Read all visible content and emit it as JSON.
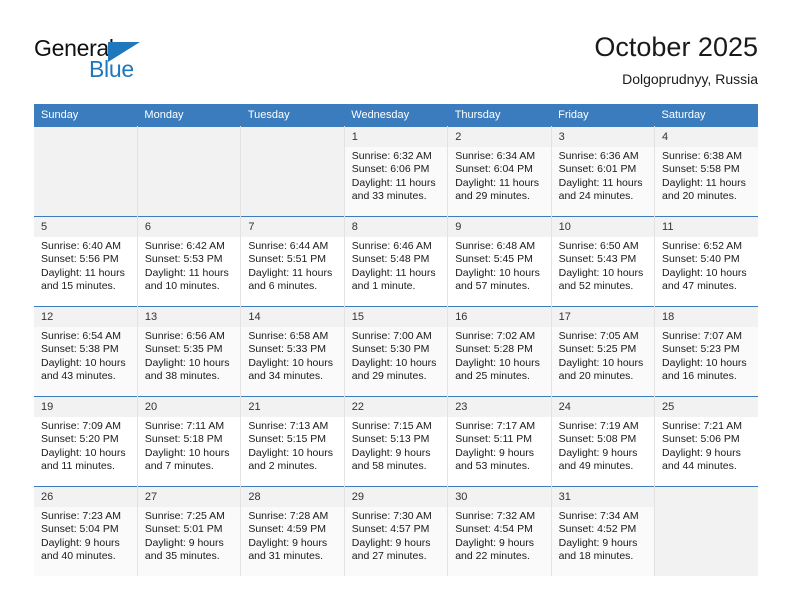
{
  "logo": {
    "word_top": "General",
    "word_bottom": "Blue",
    "accent_color": "#1f77bd"
  },
  "header": {
    "title": "October 2025",
    "subtitle": "Dolgoprudnyy, Russia"
  },
  "theme": {
    "header_bg": "#3a7cbe",
    "daynum_bg": "#f2f2f2",
    "row_shade": "#fafafa"
  },
  "weekday_headers": [
    "Sunday",
    "Monday",
    "Tuesday",
    "Wednesday",
    "Thursday",
    "Friday",
    "Saturday"
  ],
  "weeks": [
    [
      {
        "day": "",
        "sunrise": "",
        "sunset": "",
        "daylight": "",
        "empty": true
      },
      {
        "day": "",
        "sunrise": "",
        "sunset": "",
        "daylight": "",
        "empty": true
      },
      {
        "day": "",
        "sunrise": "",
        "sunset": "",
        "daylight": "",
        "empty": true
      },
      {
        "day": "1",
        "sunrise": "Sunrise: 6:32 AM",
        "sunset": "Sunset: 6:06 PM",
        "daylight": "Daylight: 11 hours and 33 minutes."
      },
      {
        "day": "2",
        "sunrise": "Sunrise: 6:34 AM",
        "sunset": "Sunset: 6:04 PM",
        "daylight": "Daylight: 11 hours and 29 minutes."
      },
      {
        "day": "3",
        "sunrise": "Sunrise: 6:36 AM",
        "sunset": "Sunset: 6:01 PM",
        "daylight": "Daylight: 11 hours and 24 minutes."
      },
      {
        "day": "4",
        "sunrise": "Sunrise: 6:38 AM",
        "sunset": "Sunset: 5:58 PM",
        "daylight": "Daylight: 11 hours and 20 minutes."
      }
    ],
    [
      {
        "day": "5",
        "sunrise": "Sunrise: 6:40 AM",
        "sunset": "Sunset: 5:56 PM",
        "daylight": "Daylight: 11 hours and 15 minutes."
      },
      {
        "day": "6",
        "sunrise": "Sunrise: 6:42 AM",
        "sunset": "Sunset: 5:53 PM",
        "daylight": "Daylight: 11 hours and 10 minutes."
      },
      {
        "day": "7",
        "sunrise": "Sunrise: 6:44 AM",
        "sunset": "Sunset: 5:51 PM",
        "daylight": "Daylight: 11 hours and 6 minutes."
      },
      {
        "day": "8",
        "sunrise": "Sunrise: 6:46 AM",
        "sunset": "Sunset: 5:48 PM",
        "daylight": "Daylight: 11 hours and 1 minute."
      },
      {
        "day": "9",
        "sunrise": "Sunrise: 6:48 AM",
        "sunset": "Sunset: 5:45 PM",
        "daylight": "Daylight: 10 hours and 57 minutes."
      },
      {
        "day": "10",
        "sunrise": "Sunrise: 6:50 AM",
        "sunset": "Sunset: 5:43 PM",
        "daylight": "Daylight: 10 hours and 52 minutes."
      },
      {
        "day": "11",
        "sunrise": "Sunrise: 6:52 AM",
        "sunset": "Sunset: 5:40 PM",
        "daylight": "Daylight: 10 hours and 47 minutes."
      }
    ],
    [
      {
        "day": "12",
        "sunrise": "Sunrise: 6:54 AM",
        "sunset": "Sunset: 5:38 PM",
        "daylight": "Daylight: 10 hours and 43 minutes."
      },
      {
        "day": "13",
        "sunrise": "Sunrise: 6:56 AM",
        "sunset": "Sunset: 5:35 PM",
        "daylight": "Daylight: 10 hours and 38 minutes."
      },
      {
        "day": "14",
        "sunrise": "Sunrise: 6:58 AM",
        "sunset": "Sunset: 5:33 PM",
        "daylight": "Daylight: 10 hours and 34 minutes."
      },
      {
        "day": "15",
        "sunrise": "Sunrise: 7:00 AM",
        "sunset": "Sunset: 5:30 PM",
        "daylight": "Daylight: 10 hours and 29 minutes."
      },
      {
        "day": "16",
        "sunrise": "Sunrise: 7:02 AM",
        "sunset": "Sunset: 5:28 PM",
        "daylight": "Daylight: 10 hours and 25 minutes."
      },
      {
        "day": "17",
        "sunrise": "Sunrise: 7:05 AM",
        "sunset": "Sunset: 5:25 PM",
        "daylight": "Daylight: 10 hours and 20 minutes."
      },
      {
        "day": "18",
        "sunrise": "Sunrise: 7:07 AM",
        "sunset": "Sunset: 5:23 PM",
        "daylight": "Daylight: 10 hours and 16 minutes."
      }
    ],
    [
      {
        "day": "19",
        "sunrise": "Sunrise: 7:09 AM",
        "sunset": "Sunset: 5:20 PM",
        "daylight": "Daylight: 10 hours and 11 minutes."
      },
      {
        "day": "20",
        "sunrise": "Sunrise: 7:11 AM",
        "sunset": "Sunset: 5:18 PM",
        "daylight": "Daylight: 10 hours and 7 minutes."
      },
      {
        "day": "21",
        "sunrise": "Sunrise: 7:13 AM",
        "sunset": "Sunset: 5:15 PM",
        "daylight": "Daylight: 10 hours and 2 minutes."
      },
      {
        "day": "22",
        "sunrise": "Sunrise: 7:15 AM",
        "sunset": "Sunset: 5:13 PM",
        "daylight": "Daylight: 9 hours and 58 minutes."
      },
      {
        "day": "23",
        "sunrise": "Sunrise: 7:17 AM",
        "sunset": "Sunset: 5:11 PM",
        "daylight": "Daylight: 9 hours and 53 minutes."
      },
      {
        "day": "24",
        "sunrise": "Sunrise: 7:19 AM",
        "sunset": "Sunset: 5:08 PM",
        "daylight": "Daylight: 9 hours and 49 minutes."
      },
      {
        "day": "25",
        "sunrise": "Sunrise: 7:21 AM",
        "sunset": "Sunset: 5:06 PM",
        "daylight": "Daylight: 9 hours and 44 minutes."
      }
    ],
    [
      {
        "day": "26",
        "sunrise": "Sunrise: 7:23 AM",
        "sunset": "Sunset: 5:04 PM",
        "daylight": "Daylight: 9 hours and 40 minutes."
      },
      {
        "day": "27",
        "sunrise": "Sunrise: 7:25 AM",
        "sunset": "Sunset: 5:01 PM",
        "daylight": "Daylight: 9 hours and 35 minutes."
      },
      {
        "day": "28",
        "sunrise": "Sunrise: 7:28 AM",
        "sunset": "Sunset: 4:59 PM",
        "daylight": "Daylight: 9 hours and 31 minutes."
      },
      {
        "day": "29",
        "sunrise": "Sunrise: 7:30 AM",
        "sunset": "Sunset: 4:57 PM",
        "daylight": "Daylight: 9 hours and 27 minutes."
      },
      {
        "day": "30",
        "sunrise": "Sunrise: 7:32 AM",
        "sunset": "Sunset: 4:54 PM",
        "daylight": "Daylight: 9 hours and 22 minutes."
      },
      {
        "day": "31",
        "sunrise": "Sunrise: 7:34 AM",
        "sunset": "Sunset: 4:52 PM",
        "daylight": "Daylight: 9 hours and 18 minutes."
      },
      {
        "day": "",
        "sunrise": "",
        "sunset": "",
        "daylight": "",
        "empty": true
      }
    ]
  ]
}
